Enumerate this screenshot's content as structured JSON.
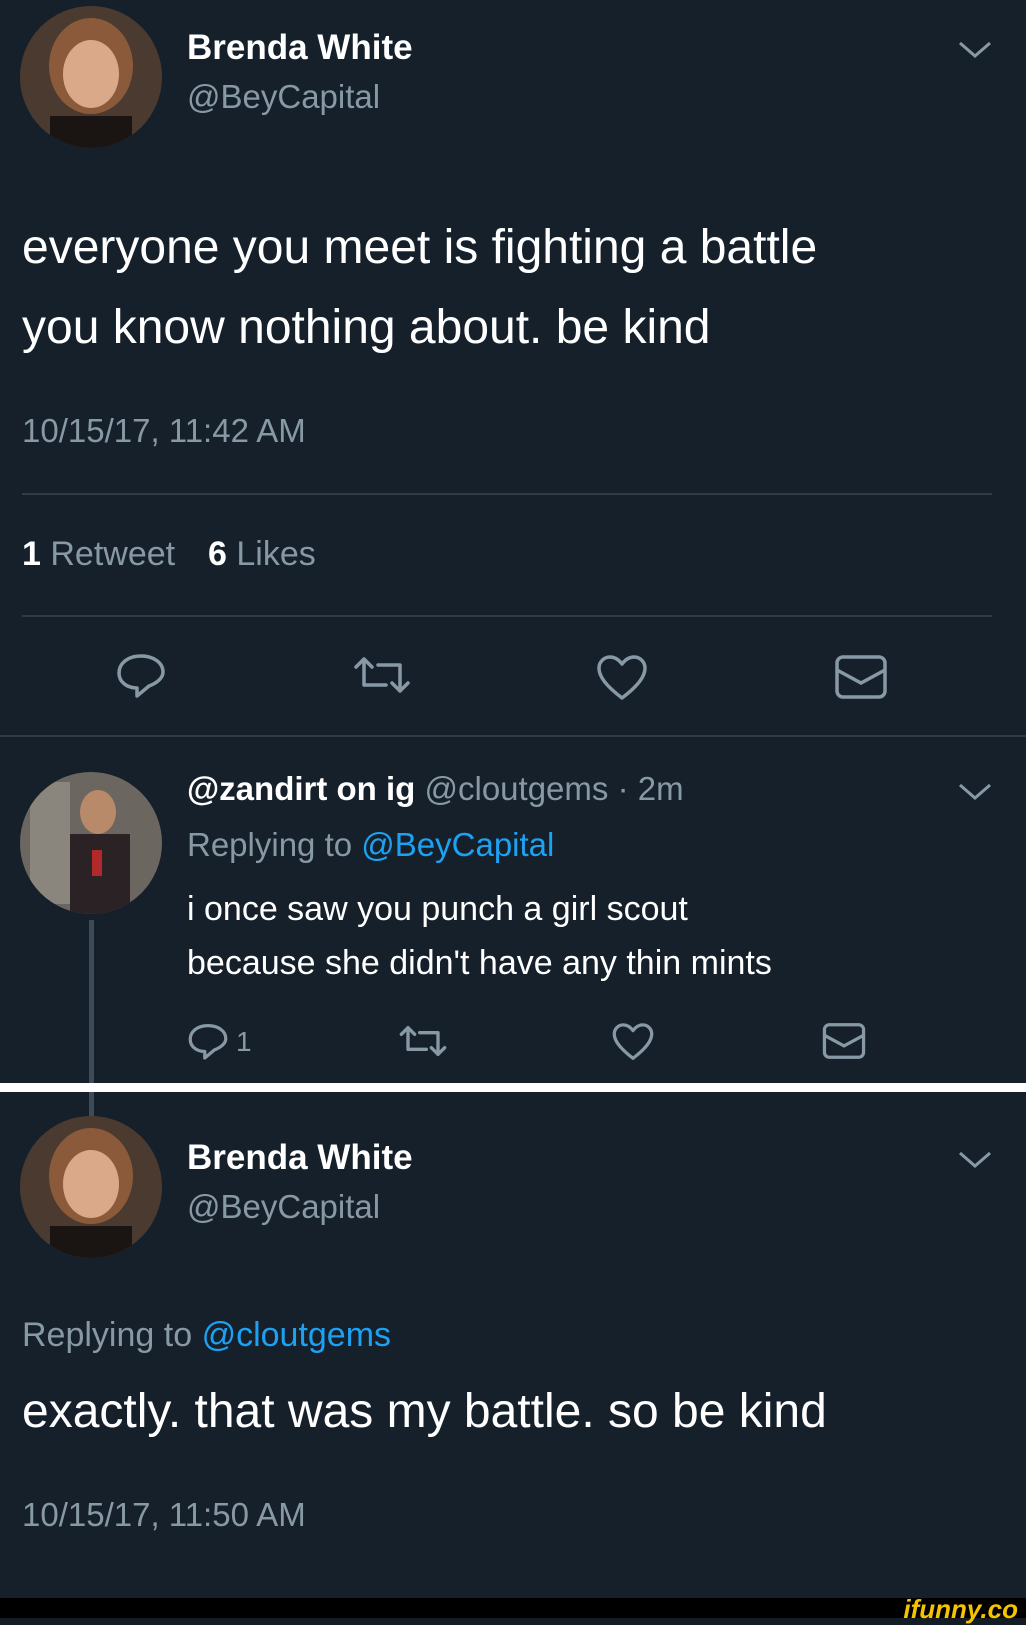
{
  "tweet1": {
    "name": "Brenda White",
    "handle": "@BeyCapital",
    "text_line1": "everyone you meet is fighting a battle",
    "text_line2": "you know nothing about. be kind",
    "timestamp": "10/15/17, 11:42 AM",
    "retweets_count": "1",
    "retweets_label": "Retweet",
    "likes_count": "6",
    "likes_label": "Likes"
  },
  "reply": {
    "name": "@zandirt on ig",
    "handle": "@cloutgems",
    "time": "· 2m",
    "replying_prefix": "Replying to",
    "replying_handle": "@BeyCapital",
    "text_line1": "i once saw you punch a girl scout",
    "text_line2": "because she didn't have any thin mints",
    "reply_count": "1"
  },
  "tweet2": {
    "name": "Brenda White",
    "handle": "@BeyCapital",
    "replying_prefix": "Replying to",
    "replying_handle": "@cloutgems",
    "text": "exactly. that was my battle. so be kind",
    "timestamp": "10/15/17, 11:50 AM"
  },
  "watermark": "ifunny.co",
  "colors": {
    "background": "#15202b",
    "link": "#1da1f2",
    "muted": "#8899a6",
    "watermark": "#f5c400"
  },
  "icons": [
    "chevron-down-icon",
    "reply-icon",
    "retweet-icon",
    "heart-icon",
    "dm-icon"
  ]
}
